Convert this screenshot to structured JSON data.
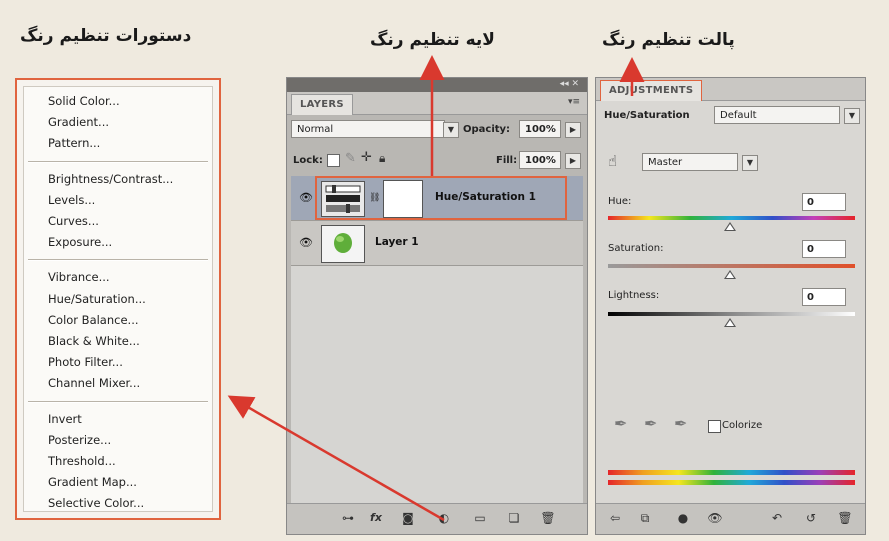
{
  "headings": {
    "menu": "دستورات تنظیم رنگ",
    "layer": "لایه تنظیم رنگ",
    "palette": "پالت تنظیم رنگ"
  },
  "colors": {
    "highlight_border": "#e0643f",
    "arrow": "#d9392e"
  },
  "menu": {
    "groups": [
      [
        "Solid Color...",
        "Gradient...",
        "Pattern..."
      ],
      [
        "Brightness/Contrast...",
        "Levels...",
        "Curves...",
        "Exposure..."
      ],
      [
        "Vibrance...",
        "Hue/Saturation...",
        "Color Balance...",
        "Black & White...",
        "Photo Filter...",
        "Channel Mixer..."
      ],
      [
        "Invert",
        "Posterize...",
        "Threshold...",
        "Gradient Map...",
        "Selective Color..."
      ]
    ]
  },
  "layers": {
    "tab": "LAYERS",
    "blend_mode": "Normal",
    "opacity_label": "Opacity:",
    "opacity_value": "100%",
    "lock_label": "Lock:",
    "fill_label": "Fill:",
    "fill_value": "100%",
    "rows": [
      {
        "name": "Hue/Saturation 1",
        "selected": true
      },
      {
        "name": "Layer 1",
        "selected": false
      }
    ],
    "footer_icons": [
      "link-icon",
      "fx-icon",
      "mask-icon",
      "adjustment-layer-icon",
      "group-folder-icon",
      "new-layer-icon",
      "trash-icon"
    ]
  },
  "adjustments": {
    "tab": "ADJUSTMENTS",
    "adjustment_name": "Hue/Saturation",
    "preset": "Default",
    "channel": "Master",
    "hue_label": "Hue:",
    "hue_value": "0",
    "saturation_label": "Saturation:",
    "saturation_value": "0",
    "lightness_label": "Lightness:",
    "lightness_value": "0",
    "colorize_label": "Colorize",
    "colorize_checked": false,
    "footer_icons": [
      "back-icon",
      "expand-view-icon",
      "clip-icon",
      "visibility-eye-icon",
      "view-previous-icon",
      "reset-icon",
      "trash-icon"
    ]
  }
}
